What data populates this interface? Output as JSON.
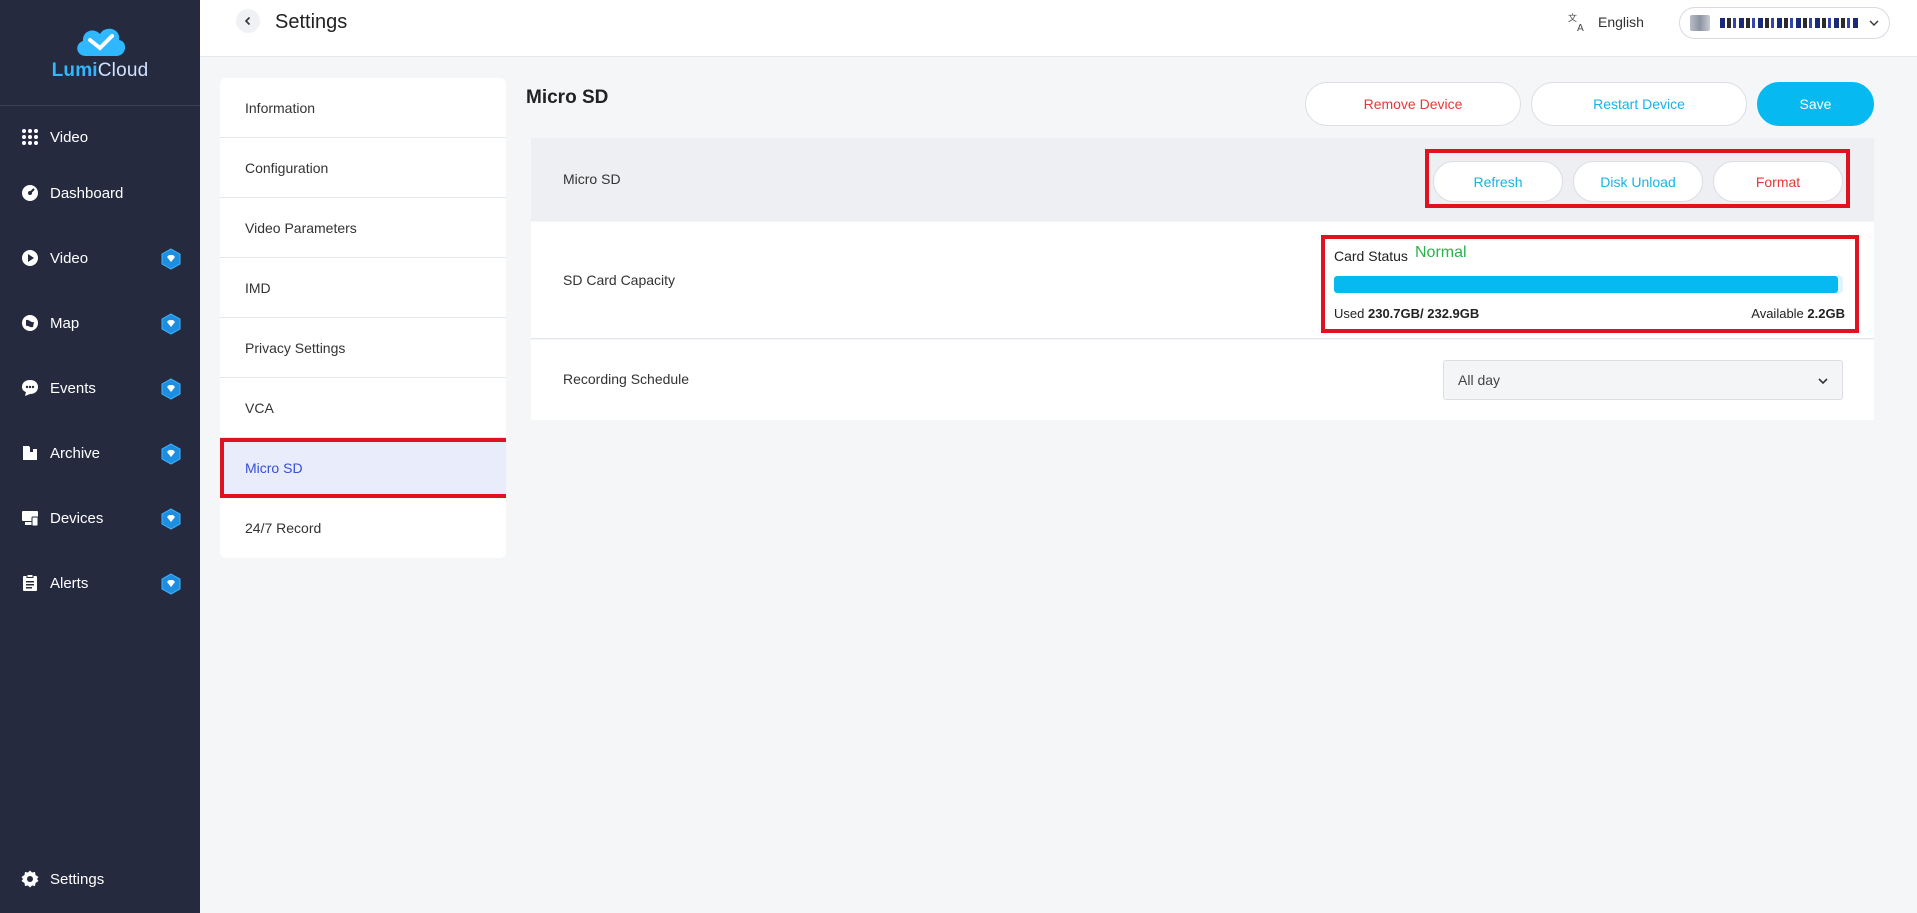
{
  "brand": {
    "name_bold": "Lumi",
    "name_light": "Cloud"
  },
  "sidebar": {
    "items": [
      {
        "label": "Video",
        "icon": "grid-icon",
        "badge": false
      },
      {
        "label": "Dashboard",
        "icon": "gauge-icon",
        "badge": false
      },
      {
        "label": "Video",
        "icon": "play-circle-icon",
        "badge": true
      },
      {
        "label": "Map",
        "icon": "map-icon",
        "badge": true
      },
      {
        "label": "Events",
        "icon": "chat-bubble-icon",
        "badge": true
      },
      {
        "label": "Archive",
        "icon": "folder-icon",
        "badge": true
      },
      {
        "label": "Devices",
        "icon": "devices-icon",
        "badge": true
      },
      {
        "label": "Alerts",
        "icon": "clipboard-icon",
        "badge": true
      }
    ],
    "settings_label": "Settings"
  },
  "header": {
    "title": "Settings",
    "language": "English"
  },
  "submenu": {
    "items": [
      "Information",
      "Configuration",
      "Video Parameters",
      "IMD",
      "Privacy Settings",
      "VCA",
      "Micro SD",
      "24/7 Record"
    ],
    "active": "Micro SD"
  },
  "main": {
    "title": "Micro SD",
    "buttons": {
      "remove": "Remove Device",
      "restart": "Restart Device",
      "save": "Save"
    },
    "sd_row": {
      "label": "Micro SD",
      "refresh": "Refresh",
      "disk_unload": "Disk Unload",
      "format": "Format"
    },
    "capacity": {
      "label": "SD Card Capacity",
      "status_label": "Card Status",
      "status_value": "Normal",
      "used_label": "Used",
      "used_value": "230.7GB/ 232.9GB",
      "available_label": "Available",
      "available_value": "2.2GB",
      "used_fraction": 0.99
    },
    "recording": {
      "label": "Recording Schedule",
      "value": "All day"
    }
  },
  "colors": {
    "sidebar_bg": "#252a3f",
    "accent": "#06b9f0",
    "danger": "#e53935",
    "status_ok": "#2bb34a",
    "highlight_box": "#e0121f"
  }
}
